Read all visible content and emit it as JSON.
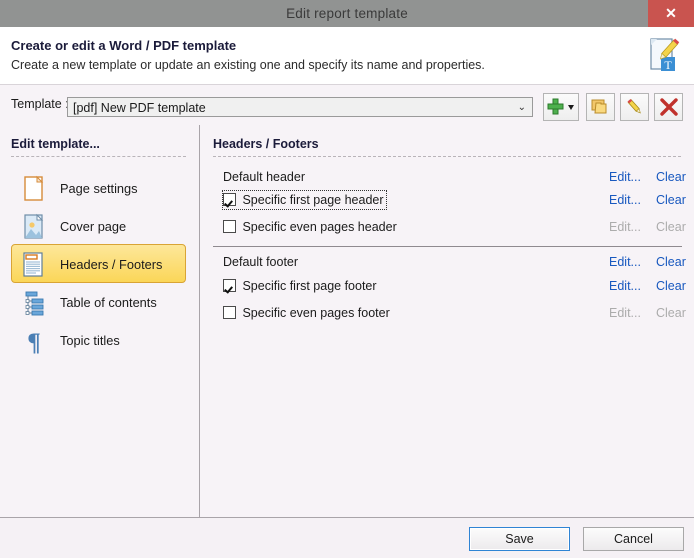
{
  "window": {
    "title": "Edit report template",
    "close_label": "✕",
    "close_icon": "close-icon"
  },
  "header": {
    "title": "Create or edit a Word / PDF template",
    "subtitle": "Create a new template or update an existing one and specify its name and properties.",
    "icon": "document-edit-template-icon"
  },
  "template_row": {
    "label": "Template :",
    "combo_value": "[pdf] New PDF template",
    "combo_arrow": "⌄",
    "buttons": [
      {
        "name": "new-template-button",
        "icon": "green-plus-dropdown-icon",
        "tooltip": "New"
      },
      {
        "name": "duplicate-template-button",
        "icon": "folder-copy-icon",
        "tooltip": "Duplicate"
      },
      {
        "name": "rename-template-button",
        "icon": "pencil-icon",
        "tooltip": "Edit"
      },
      {
        "name": "delete-template-button",
        "icon": "red-x-icon",
        "tooltip": "Delete"
      }
    ]
  },
  "sidebar": {
    "heading": "Edit template...",
    "items": [
      {
        "label": "Page settings",
        "icon": "page-icon",
        "selected": false
      },
      {
        "label": "Cover page",
        "icon": "cover-image-icon",
        "selected": false
      },
      {
        "label": "Headers / Footers",
        "icon": "header-footer-icon",
        "selected": true
      },
      {
        "label": "Table of contents",
        "icon": "tree-list-icon",
        "selected": false
      },
      {
        "label": "Topic titles",
        "icon": "pilcrow-icon",
        "selected": false
      }
    ]
  },
  "content": {
    "heading": "Headers / Footers",
    "edit_label": "Edit...",
    "clear_label": "Clear",
    "rows": [
      {
        "type": "label",
        "text": "Default header",
        "checked": false,
        "focused": false,
        "enabled": true
      },
      {
        "type": "checkbox",
        "text": "Specific first page header",
        "checked": true,
        "focused": true,
        "enabled": true
      },
      {
        "type": "checkbox",
        "text": "Specific even pages header",
        "checked": false,
        "focused": false,
        "enabled": false
      },
      {
        "type": "label",
        "text": "Default footer",
        "checked": false,
        "focused": false,
        "enabled": true
      },
      {
        "type": "checkbox",
        "text": "Specific first page footer",
        "checked": true,
        "focused": false,
        "enabled": true
      },
      {
        "type": "checkbox",
        "text": "Specific even pages footer",
        "checked": false,
        "focused": false,
        "enabled": false
      }
    ]
  },
  "footer": {
    "save_label": "Save",
    "cancel_label": "Cancel"
  },
  "colors": {
    "titlebar": "#919392",
    "close": "#c9544f",
    "body": "#f7f3f7",
    "link": "#1858bf",
    "link_disabled": "#acacac",
    "selected_start": "#fde79a",
    "selected_end": "#fbd658",
    "selected_border": "#d9a435",
    "focus_border": "#2f84d4"
  }
}
